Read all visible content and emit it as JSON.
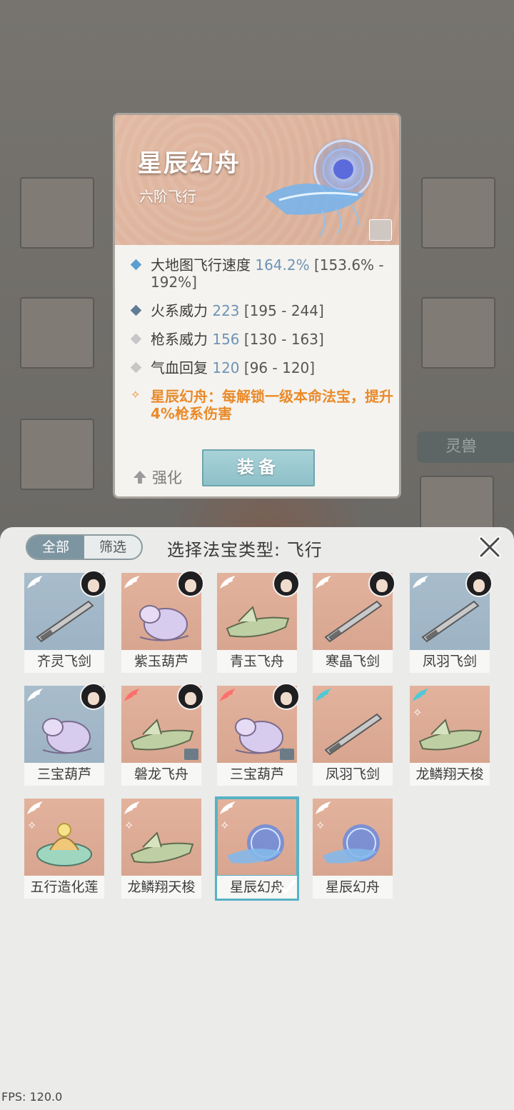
{
  "background": {
    "side_tab_label": "灵兽"
  },
  "detail": {
    "title": "星辰幻舟",
    "subtitle": "六阶飞行",
    "attributes": [
      {
        "name": "大地图飞行速度",
        "value": "164.2%",
        "range": "[153.6% - 192%]",
        "diamond_color": "#5b9fd0"
      },
      {
        "name": "火系威力",
        "value": "223",
        "range": "[195 - 244]",
        "diamond_color": "#607c96"
      },
      {
        "name": "枪系威力",
        "value": "156",
        "range": "[130 - 163]",
        "diamond_color": "#c7c7c7"
      },
      {
        "name": "气血回复",
        "value": "120",
        "range": "[96 - 120]",
        "diamond_color": "#c7c7c7"
      }
    ],
    "special_effect": "星辰幻舟：每解锁一级本命法宝，提升4%枪系伤害",
    "upgrade_label": "强化",
    "equip_label": "装备"
  },
  "sheet": {
    "segment_all": "全部",
    "segment_filter": "筛选",
    "title": "选择法宝类型: 飞行",
    "items": [
      {
        "label": "齐灵飞剑",
        "bg": "blue",
        "avatar": true,
        "lock": false,
        "rune": false,
        "wing_color": "#ffffff",
        "art": "sword"
      },
      {
        "label": "紫玉葫芦",
        "bg": "pink",
        "avatar": true,
        "lock": false,
        "rune": false,
        "wing_color": "#ffffff",
        "art": "gourd"
      },
      {
        "label": "青玉飞舟",
        "bg": "pink",
        "avatar": true,
        "lock": false,
        "rune": false,
        "wing_color": "#ffffff",
        "art": "boat"
      },
      {
        "label": "寒晶飞剑",
        "bg": "pink",
        "avatar": true,
        "lock": false,
        "rune": false,
        "wing_color": "#ffffff",
        "art": "sword"
      },
      {
        "label": "凤羽飞剑",
        "bg": "blue",
        "avatar": true,
        "lock": false,
        "rune": false,
        "wing_color": "#ffffff",
        "art": "sword"
      },
      {
        "label": "三宝葫芦",
        "bg": "blue",
        "avatar": true,
        "lock": false,
        "rune": false,
        "wing_color": "#ffffff",
        "art": "gourd"
      },
      {
        "label": "磐龙飞舟",
        "bg": "pink",
        "avatar": true,
        "lock": true,
        "rune": false,
        "wing_color": "#ff6f6f",
        "art": "boat"
      },
      {
        "label": "三宝葫芦",
        "bg": "pink",
        "avatar": true,
        "lock": true,
        "rune": false,
        "wing_color": "#ff6f6f",
        "art": "gourd"
      },
      {
        "label": "凤羽飞剑",
        "bg": "pink",
        "avatar": false,
        "lock": false,
        "rune": false,
        "wing_color": "#4fc9d6",
        "art": "sword"
      },
      {
        "label": "龙鳞翔天梭",
        "bg": "pink",
        "avatar": false,
        "lock": false,
        "rune": true,
        "wing_color": "#4fc9d6",
        "art": "boat"
      },
      {
        "label": "五行造化莲",
        "bg": "pink",
        "avatar": false,
        "lock": false,
        "rune": true,
        "wing_color": "#ffffff",
        "art": "lotus"
      },
      {
        "label": "龙鳞翔天梭",
        "bg": "pink",
        "avatar": false,
        "lock": false,
        "rune": true,
        "wing_color": "#ffffff",
        "art": "boat"
      },
      {
        "label": "星辰幻舟",
        "bg": "pink",
        "avatar": false,
        "lock": false,
        "rune": true,
        "wing_color": "#ffffff",
        "art": "star",
        "selected": true
      },
      {
        "label": "星辰幻舟",
        "bg": "pink",
        "avatar": false,
        "lock": false,
        "rune": true,
        "wing_color": "#ffffff",
        "art": "star"
      }
    ]
  },
  "fps_text": "FPS: 120.0"
}
